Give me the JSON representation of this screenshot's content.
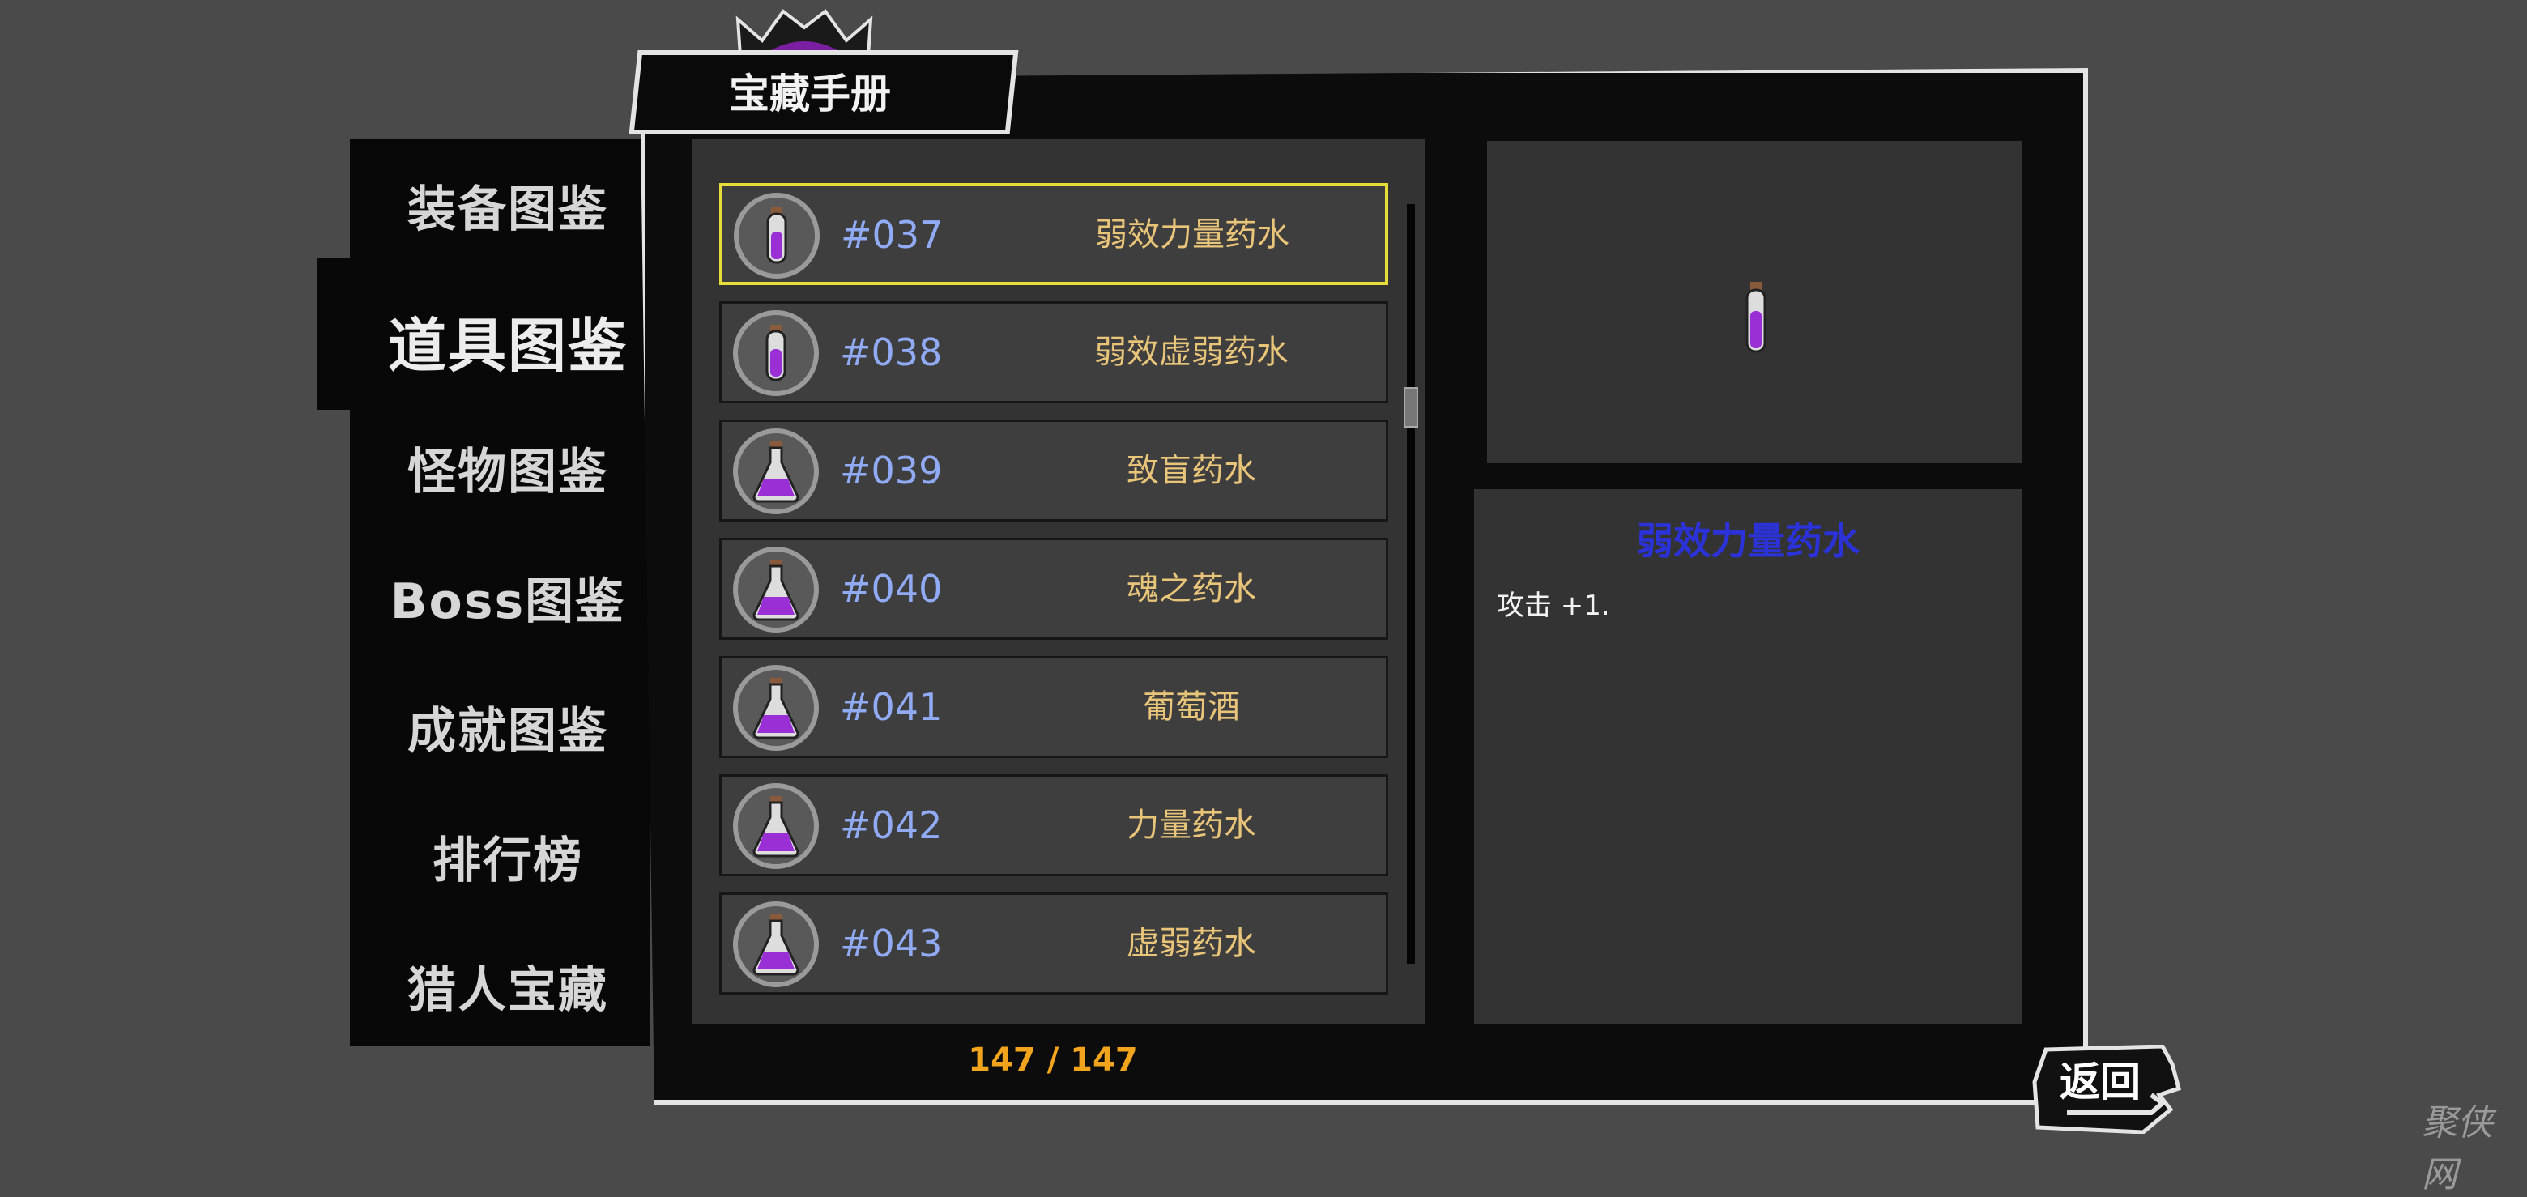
{
  "header": {
    "title": "宝藏手册"
  },
  "sidebar": {
    "items": [
      {
        "label": "装备图鉴"
      },
      {
        "label": "道具图鉴"
      },
      {
        "label": "怪物图鉴"
      },
      {
        "label": "Boss图鉴"
      },
      {
        "label": "成就图鉴"
      },
      {
        "label": "排行榜"
      },
      {
        "label": "猎人宝藏"
      }
    ],
    "active_index": 1
  },
  "item_list": {
    "rows": [
      {
        "number": "#037",
        "name": "弱效力量药水",
        "icon": "thin-potion-icon",
        "selected": true
      },
      {
        "number": "#038",
        "name": "弱效虚弱药水",
        "icon": "thin-potion-icon",
        "selected": false
      },
      {
        "number": "#039",
        "name": "致盲药水",
        "icon": "flask-potion-icon",
        "selected": false
      },
      {
        "number": "#040",
        "name": "魂之药水",
        "icon": "flask-potion-icon",
        "selected": false
      },
      {
        "number": "#041",
        "name": "葡萄酒",
        "icon": "flask-potion-icon",
        "selected": false
      },
      {
        "number": "#042",
        "name": "力量药水",
        "icon": "flask-potion-icon",
        "selected": false
      },
      {
        "number": "#043",
        "name": "虚弱药水",
        "icon": "flask-potion-icon",
        "selected": false
      }
    ],
    "counter": "147 / 147",
    "scroll_position": 0.25
  },
  "detail": {
    "title": "弱效力量药水",
    "description": "攻击 +1.",
    "icon": "thin-potion-icon"
  },
  "footer": {
    "back_label": "返回"
  },
  "watermark": {
    "text": "聚侠网"
  },
  "colors": {
    "background": "#4a4a4a",
    "panel": "#0c0c0c",
    "selected_border": "#e6dc3a",
    "item_number": "#90aaf4",
    "item_name": "#e9c57a",
    "detail_title": "#2a32d8",
    "counter": "#f2a51c"
  }
}
